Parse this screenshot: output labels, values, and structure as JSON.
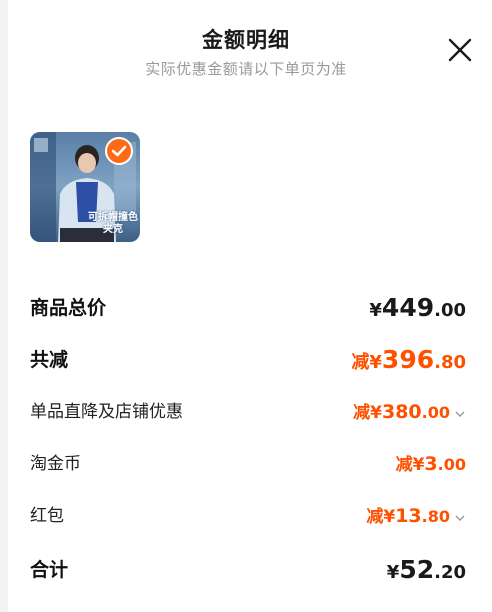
{
  "header": {
    "title": "金额明细",
    "subtitle": "实际优惠金额请以下单页为准"
  },
  "product": {
    "thumbnail_caption": "可拆帽撞色\n夹克",
    "selected": true
  },
  "rows": [
    {
      "label": "商品总价",
      "prefix": "¥",
      "int": "449",
      "dec": ".00",
      "color": "#1a1a1a"
    },
    {
      "label": "共减",
      "prefix": "减¥",
      "int": "396",
      "dec": ".80",
      "color": "#ff5000"
    },
    {
      "label": "单品直降及店铺优惠",
      "prefix": "减¥",
      "int": "380",
      "dec": ".00",
      "color": "#ff5000",
      "expandable": true
    },
    {
      "label": "淘金币",
      "prefix": "减¥",
      "int": "3",
      "dec": ".00",
      "color": "#ff5000"
    },
    {
      "label": "红包",
      "prefix": "减¥",
      "int": "13",
      "dec": ".80",
      "color": "#ff5000",
      "expandable": true
    },
    {
      "label": "合计",
      "prefix": "¥",
      "int": "52",
      "dec": ".20",
      "color": "#1a1a1a"
    }
  ],
  "icons": {
    "close": "close-icon",
    "check": "check-icon",
    "chevron": "chevron-down-icon"
  },
  "colors": {
    "accent": "#ff5000",
    "badge": "#ff6a14"
  }
}
